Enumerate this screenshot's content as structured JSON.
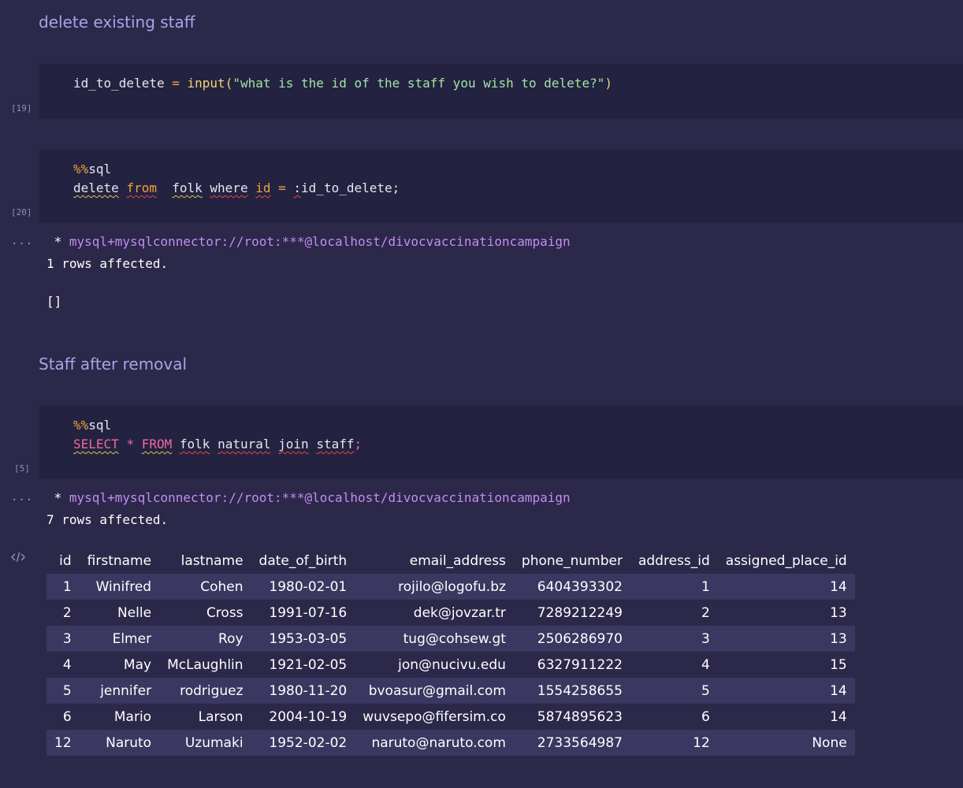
{
  "cells": [
    {
      "type": "markdown",
      "text": "delete existing staff"
    },
    {
      "type": "code",
      "execution_count": "[19]",
      "code": {
        "var": "id_to_delete",
        "op": "=",
        "fn": "input",
        "open": "(",
        "string": "\"what is the id of the staff you wish to delete?\"",
        "close": ")"
      }
    },
    {
      "type": "code",
      "execution_count": "[20]",
      "magic_prefix": "%%",
      "magic_name": "sql",
      "tokens": [
        "delete",
        "from",
        "folk",
        "where",
        "id",
        "=",
        ":",
        "id_to_delete",
        ";"
      ],
      "output": {
        "ellipsis": "...",
        "connection_star": " * ",
        "connection": "mysql+mysqlconnector://root:***@localhost/divocvaccinationcampaign",
        "status": "1 rows affected.",
        "result": "[]"
      }
    },
    {
      "type": "markdown",
      "text": "Staff after removal"
    },
    {
      "type": "code",
      "execution_count": "[5]",
      "magic_prefix": "%%",
      "magic_name": "sql",
      "tokens": [
        "SELECT",
        "*",
        "FROM",
        "folk",
        "natural",
        "join",
        "staff",
        ";"
      ],
      "output": {
        "ellipsis": "...",
        "connection_star": " * ",
        "connection": "mysql+mysqlconnector://root:***@localhost/divocvaccinationcampaign",
        "status": "7 rows affected.",
        "icon": "code-icon",
        "table": {
          "columns": [
            "id",
            "firstname",
            "lastname",
            "date_of_birth",
            "email_address",
            "phone_number",
            "address_id",
            "assigned_place_id"
          ],
          "rows": [
            [
              "1",
              "Winifred",
              "Cohen",
              "1980-02-01",
              "rojilo@logofu.bz",
              "6404393302",
              "1",
              "14"
            ],
            [
              "2",
              "Nelle",
              "Cross",
              "1991-07-16",
              "dek@jovzar.tr",
              "7289212249",
              "2",
              "13"
            ],
            [
              "3",
              "Elmer",
              "Roy",
              "1953-03-05",
              "tug@cohsew.gt",
              "2506286970",
              "3",
              "13"
            ],
            [
              "4",
              "May",
              "McLaughlin",
              "1921-02-05",
              "jon@nucivu.edu",
              "6327911222",
              "4",
              "15"
            ],
            [
              "5",
              "jennifer",
              "rodriguez",
              "1980-11-20",
              "bvoasur@gmail.com",
              "1554258655",
              "5",
              "14"
            ],
            [
              "6",
              "Mario",
              "Larson",
              "2004-10-19",
              "wuvsepo@fifersim.co",
              "5874895623",
              "6",
              "14"
            ],
            [
              "12",
              "Naruto",
              "Uzumaki",
              "1952-02-02",
              "naruto@naruto.com",
              "2733564987",
              "12",
              "None"
            ]
          ]
        }
      }
    }
  ],
  "colors": {
    "background": "#2b2849",
    "cell_background": "#232241",
    "heading": "#a9a3e6",
    "connection": "#c58cf2",
    "keyword_orange": "#f0a33a",
    "function_yellow": "#f1d56b",
    "string_green": "#a6e3a1",
    "keyword_pink": "#f06b9b",
    "table_stripe": "#3a3760"
  }
}
